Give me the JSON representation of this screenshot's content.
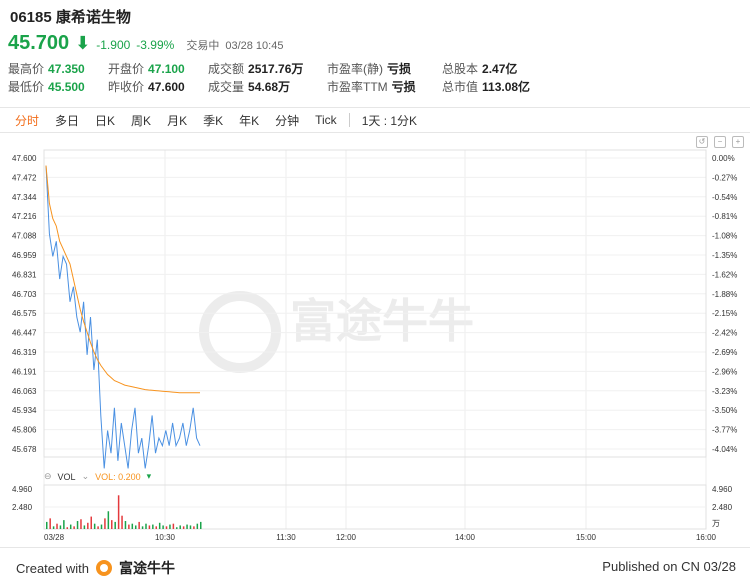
{
  "header": {
    "title": "06185 康希诺生物"
  },
  "quote": {
    "price": "45.700",
    "change": "-1.900",
    "change_pct": "-3.99%",
    "status": "交易中",
    "time": "03/28 10:45"
  },
  "stats": {
    "high_label": "最高价",
    "high": "47.350",
    "low_label": "最低价",
    "low": "45.500",
    "open_label": "开盘价",
    "open": "47.100",
    "prev_label": "昨收价",
    "prev": "47.600",
    "turnover_label": "成交额",
    "turnover": "2517.76万",
    "volume_label": "成交量",
    "volume": "54.68万",
    "pe_static_label": "市盈率(静)",
    "pe_static": "亏损",
    "pe_ttm_label": "市盈率TTM",
    "pe_ttm": "亏损",
    "shares_label": "总股本",
    "shares": "2.47亿",
    "mcap_label": "总市值",
    "mcap": "113.08亿"
  },
  "tabs": [
    "分时",
    "多日",
    "日K",
    "周K",
    "月K",
    "季K",
    "年K",
    "分钟",
    "Tick"
  ],
  "active_tab": "分时",
  "period_label": "1天 : 1分K",
  "watermark": "富途牛牛",
  "chart_data": {
    "type": "line",
    "y_ticks_left": [
      "47.600",
      "47.472",
      "47.344",
      "47.216",
      "47.088",
      "46.959",
      "46.831",
      "46.703",
      "46.575",
      "46.447",
      "46.319",
      "46.191",
      "46.063",
      "45.934",
      "45.806",
      "45.678"
    ],
    "y_ticks_right": [
      "0.00%",
      "-0.27%",
      "-0.54%",
      "-0.81%",
      "-1.08%",
      "-1.35%",
      "-1.62%",
      "-1.88%",
      "-2.15%",
      "-2.42%",
      "-2.69%",
      "-2.96%",
      "-3.23%",
      "-3.50%",
      "-3.77%",
      "-4.04%"
    ],
    "ylim": [
      45.678,
      47.6
    ],
    "x_labels": [
      "03/28",
      "10:30",
      "11:30",
      "12:00",
      "14:00",
      "15:00",
      "16:00"
    ],
    "series": [
      {
        "color": "#4a90e2",
        "values": [
          47.55,
          47.1,
          46.95,
          47.05,
          46.8,
          46.95,
          46.9,
          46.65,
          46.75,
          46.55,
          46.45,
          46.65,
          46.3,
          46.55,
          46.2,
          46.4,
          45.9,
          45.55,
          45.8,
          45.65,
          45.95,
          45.6,
          45.85,
          45.7,
          45.55,
          45.8,
          45.95,
          45.65,
          45.75,
          45.55,
          45.7,
          45.9,
          45.65,
          45.75,
          45.7,
          45.8,
          45.7,
          45.85,
          45.7,
          45.75,
          45.85,
          45.7,
          45.8,
          45.95,
          45.75,
          45.7
        ]
      },
      {
        "color": "#f7931e",
        "values": [
          47.55,
          47.3,
          47.2,
          47.15,
          47.05,
          47.0,
          46.95,
          46.9,
          46.8,
          46.7,
          46.6,
          46.52,
          46.45,
          46.38,
          46.32,
          46.27,
          46.23,
          46.2,
          46.17,
          46.15,
          46.13,
          46.12,
          46.11,
          46.1,
          46.095,
          46.09,
          46.085,
          46.08,
          46.075,
          46.07,
          46.068,
          46.066,
          46.064,
          46.062,
          46.06,
          46.058,
          46.056,
          46.054,
          46.052,
          46.05,
          46.05,
          46.05,
          46.05,
          46.05,
          46.05,
          46.05
        ]
      }
    ],
    "volume": {
      "ticks_left": [
        "4.960",
        "2.480"
      ],
      "ticks_right": [
        "4.960",
        "2.480"
      ],
      "unit": "万",
      "legend_vol": "VOL",
      "legend_vol2": "VOL: 0.200",
      "values": [
        0.8,
        1.2,
        0.3,
        0.6,
        0.4,
        1.0,
        0.2,
        0.5,
        0.3,
        0.9,
        1.1,
        0.4,
        0.7,
        1.4,
        0.6,
        0.3,
        0.5,
        1.2,
        2.0,
        1.0,
        0.8,
        3.8,
        1.5,
        0.9,
        0.5,
        0.6,
        0.4,
        0.8,
        0.3,
        0.6,
        0.4,
        0.5,
        0.3,
        0.7,
        0.4,
        0.3,
        0.5,
        0.6,
        0.2,
        0.4,
        0.3,
        0.5,
        0.4,
        0.3,
        0.6,
        0.8
      ],
      "colors": [
        "g",
        "r",
        "g",
        "r",
        "g",
        "g",
        "r",
        "g",
        "r",
        "g",
        "r",
        "g",
        "r",
        "r",
        "g",
        "r",
        "g",
        "r",
        "g",
        "r",
        "g",
        "r",
        "r",
        "g",
        "r",
        "g",
        "g",
        "r",
        "g",
        "g",
        "r",
        "g",
        "r",
        "g",
        "g",
        "r",
        "g",
        "r",
        "g",
        "g",
        "r",
        "g",
        "g",
        "r",
        "g",
        "g"
      ],
      "ylim": [
        0,
        4.96
      ]
    }
  },
  "footer": {
    "created_with": "Created with",
    "brand": "富途牛牛",
    "published": "Published on CN 03/28"
  }
}
